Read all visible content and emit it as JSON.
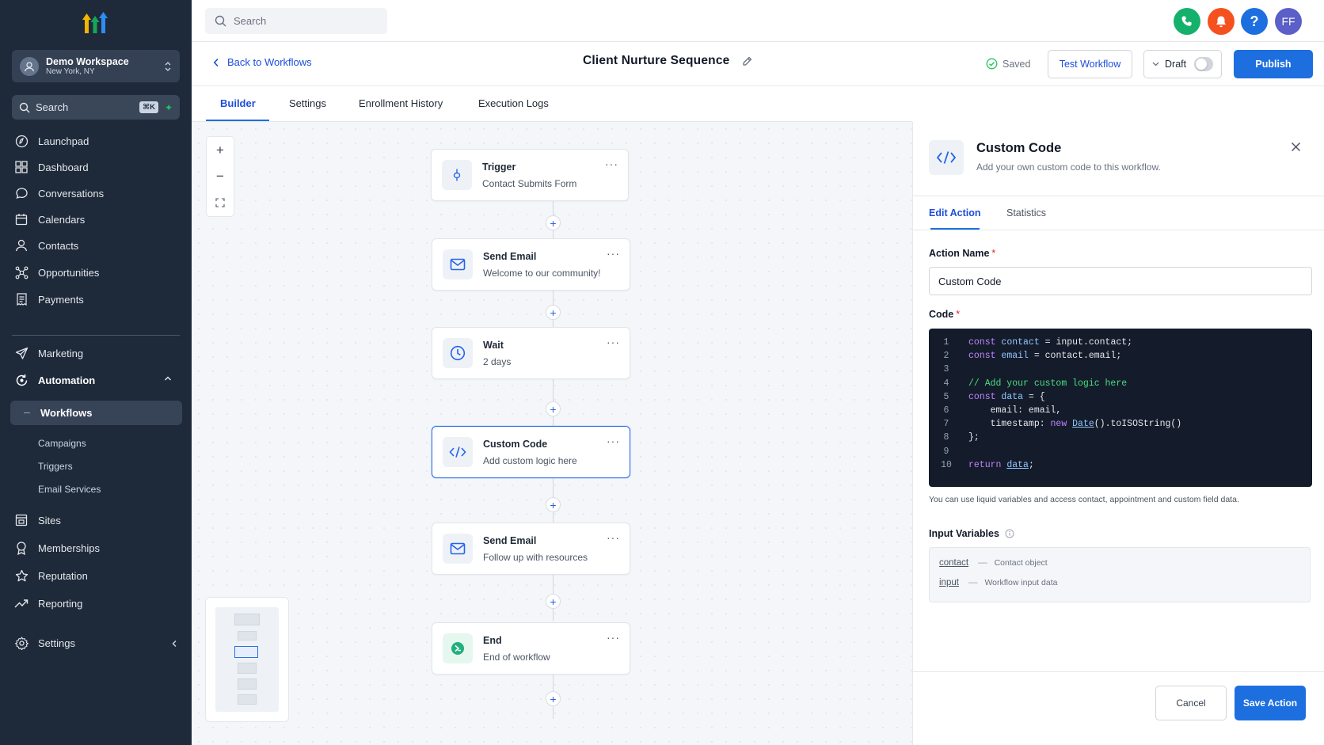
{
  "sidebar": {
    "workspace": {
      "name": "Demo Workspace",
      "location": "New York, NY"
    },
    "search": {
      "label": "Search",
      "shortcut": "⌘K"
    },
    "nav": [
      {
        "label": "Launchpad",
        "icon": "launchpad-icon"
      },
      {
        "label": "Dashboard",
        "icon": "dashboard-icon"
      },
      {
        "label": "Conversations",
        "icon": "chat-bubble-icon"
      },
      {
        "label": "Calendars",
        "icon": "calendar-icon"
      },
      {
        "label": "Contacts",
        "icon": "user-icon"
      },
      {
        "label": "Opportunities",
        "icon": "network-icon"
      },
      {
        "label": "Payments",
        "icon": "receipt-icon"
      },
      {
        "label": "Marketing",
        "icon": "send-icon"
      },
      {
        "label": "Automation",
        "icon": "automation-icon"
      }
    ],
    "automation_sub": {
      "active": "Workflows",
      "items": [
        "Campaigns",
        "Triggers",
        "Email Services"
      ]
    },
    "nav_bottom": [
      {
        "label": "Sites",
        "icon": "sites-icon"
      },
      {
        "label": "Memberships",
        "icon": "membership-icon"
      },
      {
        "label": "Reputation",
        "icon": "star-icon"
      },
      {
        "label": "Reporting",
        "icon": "trend-icon"
      },
      {
        "label": "Settings",
        "icon": "gear-icon"
      }
    ]
  },
  "topbar": {
    "search_placeholder": "Search",
    "avatar_initials": "FF",
    "help_label": "?",
    "colors": {
      "phone": "#15b16c",
      "bell": "#f4511e",
      "help": "#1d6fe0",
      "avatar": "#5b5fc7"
    }
  },
  "header": {
    "back_label": "Back to Workflows",
    "title": "Client Nurture Sequence",
    "saved_label": "Saved",
    "test_label": "Test Workflow",
    "draft_label": "Draft",
    "publish_label": "Publish"
  },
  "tabs": [
    {
      "label": "Builder",
      "active": true
    },
    {
      "label": "Settings",
      "active": false
    },
    {
      "label": "Enrollment History",
      "active": false
    },
    {
      "label": "Execution Logs",
      "active": false
    }
  ],
  "canvas": {
    "zoom": {
      "in": "+",
      "out": "−"
    },
    "add_step_label": "+",
    "nodes": [
      {
        "title": "Trigger",
        "subtitle": "Contact Submits Form",
        "icon": "lightning-icon"
      },
      {
        "title": "Send Email",
        "subtitle": "Welcome to our community!",
        "icon": "mail-icon"
      },
      {
        "title": "Wait",
        "subtitle": "2 days",
        "icon": "clock-icon"
      },
      {
        "title": "Custom Code",
        "subtitle": "Add custom logic here",
        "icon": "code-icon",
        "selected": true
      },
      {
        "title": "Send Email",
        "subtitle": "Follow up with resources",
        "icon": "mail-icon"
      },
      {
        "title": "End",
        "subtitle": "End of workflow",
        "icon": "end-icon"
      }
    ]
  },
  "panel": {
    "title": "Custom Code",
    "subtitle": "Add your own custom code to this workflow.",
    "tabs": [
      {
        "label": "Edit Action",
        "active": true
      },
      {
        "label": "Statistics",
        "active": false
      }
    ],
    "action_name_label": "Action Name",
    "action_name_value": "Custom Code",
    "code_label": "Code",
    "required_mark": "*",
    "code_lines": [
      "1",
      "2",
      "3",
      "4",
      "5",
      "6",
      "7",
      "8",
      "9",
      "10"
    ],
    "code": {
      "l1": {
        "kw": "const",
        "var": "contact",
        "rest": " = input.contact;"
      },
      "l2": {
        "kw": "const",
        "var": "email",
        "rest": " = contact.email;"
      },
      "l4": "// Add your custom logic here",
      "l5": {
        "kw": "const",
        "var": "data",
        "rest": " = {"
      },
      "l6": "    email: email,",
      "l7": {
        "pre": "    timestamp: ",
        "kw": "new",
        "fn": "Date",
        "rest": "().toISOString()"
      },
      "l8": "};",
      "l10": {
        "kw": "return",
        "var": "data",
        "rest": ";"
      }
    },
    "help_text": "You can use liquid variables and access contact, appointment and custom field data.",
    "input_vars_label": "Input Variables",
    "separator": "—",
    "input_vars": [
      {
        "name": "contact",
        "desc": "Contact object"
      },
      {
        "name": "input",
        "desc": "Workflow input data"
      }
    ],
    "cancel_label": "Cancel",
    "save_label": "Save Action"
  }
}
